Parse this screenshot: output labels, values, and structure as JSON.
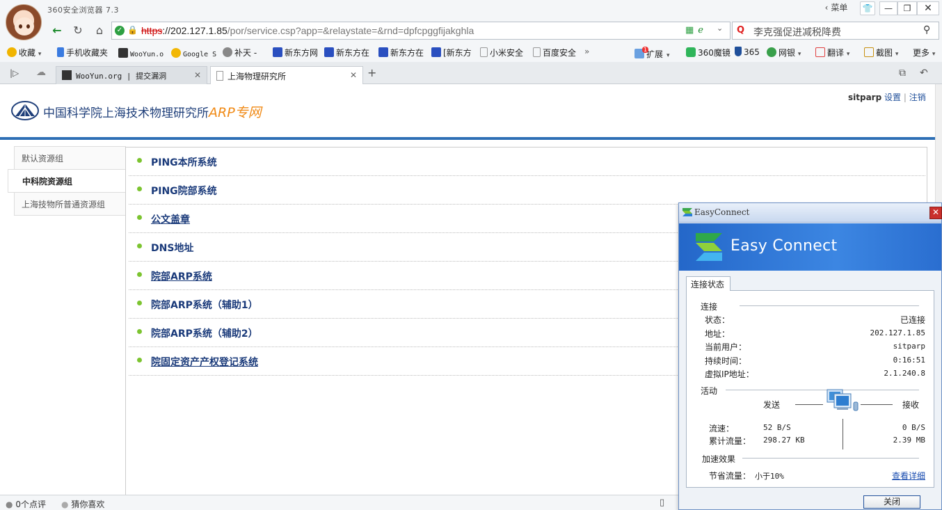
{
  "browser": {
    "title": "360安全浏览器 7.3",
    "menu_label": "菜单",
    "url": {
      "scheme": "https",
      "host": "://202.127.1.85",
      "path": "/por/service.csp?app=&relaystate=&rnd=dpfcpggfijakghla"
    },
    "search_text": "李克强促进减税降费",
    "bookmarks": [
      {
        "label": "收藏",
        "icon": "star-icon",
        "color": "#f0b400"
      },
      {
        "label": "手机收藏夹",
        "icon": "phone-icon",
        "color": "#3a7be0"
      },
      {
        "label": "WooYun.o",
        "icon": "wooyun-icon",
        "color": "#333333"
      },
      {
        "label": "Google S",
        "icon": "bell-icon",
        "color": "#f2b705"
      },
      {
        "label": "补天 -",
        "icon": "butian-icon",
        "color": "#666666"
      },
      {
        "label": "新东方网",
        "icon": "paw-icon",
        "color": "#2a4fc0"
      },
      {
        "label": "新东方在",
        "icon": "xdf-icon",
        "color": "#2a4fc0"
      },
      {
        "label": "新东方在",
        "icon": "xdf-icon",
        "color": "#2a4fc0"
      },
      {
        "label": "[新东方",
        "icon": "paw-icon",
        "color": "#2a4fc0"
      },
      {
        "label": "小米安全",
        "icon": "doc-icon",
        "color": "#999999"
      },
      {
        "label": "百度安全",
        "icon": "doc-icon",
        "color": "#999999"
      }
    ],
    "right_tools": [
      {
        "label": "扩展",
        "badge": "1"
      },
      {
        "label": "360魔镜"
      },
      {
        "label": "365"
      },
      {
        "label": "网银"
      },
      {
        "label": "翻译"
      },
      {
        "label": "截图"
      },
      {
        "label": "更多"
      }
    ],
    "tabs": [
      {
        "label": "WooYun.org | 提交漏洞"
      },
      {
        "label": "上海物理研究所"
      }
    ],
    "status": {
      "comments": "0个点评",
      "guess": "猜你喜欢"
    }
  },
  "site": {
    "title_main": "中国科学院上海技术物理研究所",
    "title_arp": "ARP专网",
    "username": "sitparp",
    "settings_label": "设置",
    "separator": "|",
    "logout_label": "注销"
  },
  "resource_groups": [
    {
      "label": "默认资源组",
      "active": false
    },
    {
      "label": "中科院资源组",
      "active": true
    },
    {
      "label": "上海技物所普通资源组",
      "active": false
    }
  ],
  "resources": [
    {
      "label": "PING本所系统",
      "underline": false
    },
    {
      "label": "PING院部系统",
      "underline": false
    },
    {
      "label": "公文盖章",
      "underline": true
    },
    {
      "label": "DNS地址",
      "underline": false
    },
    {
      "label": "院部ARP系统",
      "underline": true
    },
    {
      "label": "院部ARP系统（辅助1）",
      "underline": false
    },
    {
      "label": "院部ARP系统（辅助2）",
      "underline": false
    },
    {
      "label": "院固定资产产权登记系统",
      "underline": true
    }
  ],
  "easyconnect": {
    "window_title": "EasyConnect",
    "brand": "Easy Connect",
    "tab_label": "连接状态",
    "connection": {
      "section": "连接",
      "rows": [
        {
          "label": "状态：",
          "value": "已连接"
        },
        {
          "label": "地址：",
          "value": "202.127.1.85"
        },
        {
          "label": "当前用户：",
          "value": "sitparp"
        },
        {
          "label": "持续时间：",
          "value": "0:16:51"
        },
        {
          "label": "虚拟IP地址：",
          "value": "2.1.240.8"
        }
      ]
    },
    "activity": {
      "section": "活动",
      "send_label": "发送",
      "recv_label": "接收",
      "rate_label": "流速：",
      "rate_send": "52 B/S",
      "rate_recv": "0 B/S",
      "total_label": "累计流量：",
      "total_send": "298.27 KB",
      "total_recv": "2.39 MB"
    },
    "acceleration": {
      "section": "加速效果",
      "saved_label": "节省流量：",
      "saved_value": "小于10%",
      "detail_link": "查看详细"
    },
    "close_button": "关闭"
  }
}
